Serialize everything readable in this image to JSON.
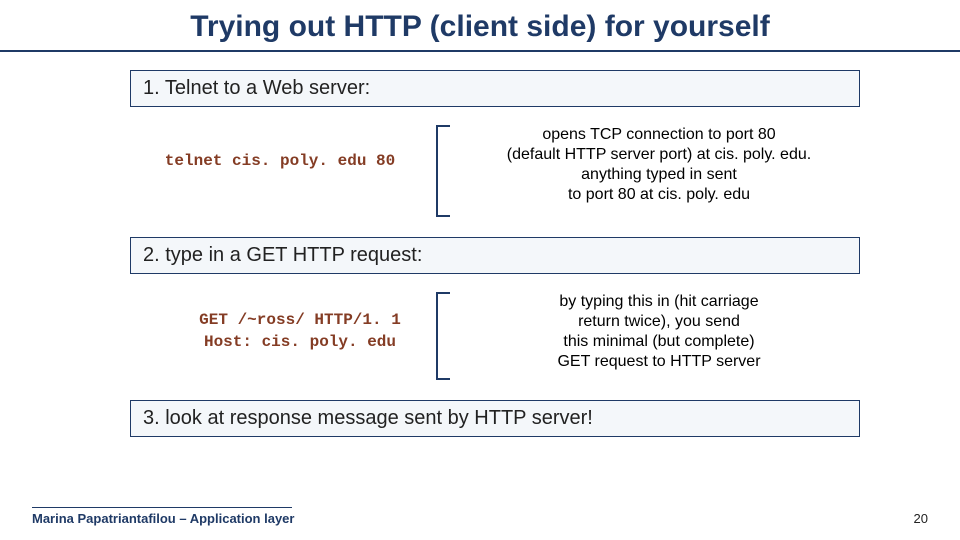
{
  "title": "Trying out HTTP (client side) for yourself",
  "steps": {
    "s1": "1. Telnet to a Web server:",
    "s2": "2. type in a GET HTTP request:",
    "s3": "3. look at response message sent by HTTP server!"
  },
  "code1": "telnet cis. poly. edu 80",
  "desc1": "opens TCP connection to port 80\n(default HTTP server port) at cis. poly. edu.\nanything typed in sent\nto port 80 at cis. poly. edu",
  "code2": "GET /~ross/ HTTP/1. 1\nHost: cis. poly. edu",
  "desc2": "by typing this in (hit carriage\nreturn twice), you send\nthis minimal (but complete)\nGET request to HTTP server",
  "footer": {
    "author": "Marina Papatriantafilou – Application layer",
    "page": "20"
  }
}
